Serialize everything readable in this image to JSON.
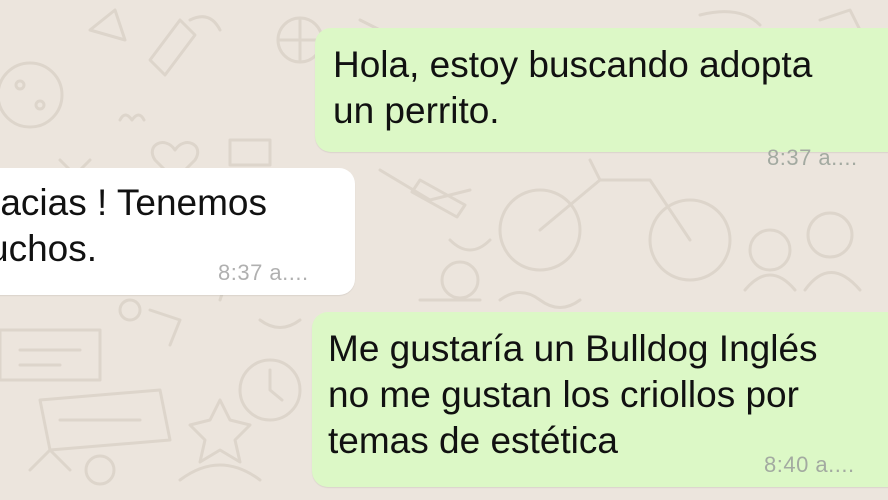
{
  "chat": {
    "messages": [
      {
        "direction": "outgoing",
        "text": "Hola, estoy buscando adopta\nun perrito.",
        "time": "8:37 a...."
      },
      {
        "direction": "incoming",
        "text": "racias ! Tenemos\nuchos.",
        "time": "8:37 a...."
      },
      {
        "direction": "outgoing",
        "text": "Me gustaría un Bulldog Inglés\nno me gustan los criollos por\ntemas de estética",
        "time": "8:40 a...."
      }
    ]
  },
  "colors": {
    "background": "#ece5dd",
    "outgoing_bubble": "#dcf8c6",
    "incoming_bubble": "#ffffff",
    "timestamp": "#a3aaa1"
  }
}
